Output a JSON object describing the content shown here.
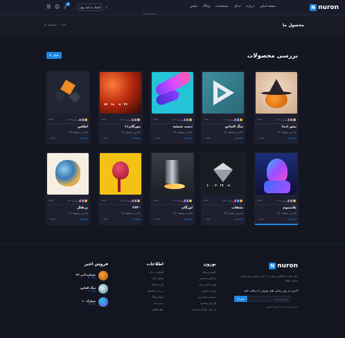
{
  "header": {
    "logo": "nuron",
    "nav": [
      "صفحه اصلی",
      "درباره",
      "جدال",
      "مشخصات",
      "وبلاگ",
      "تماس"
    ],
    "search_placeholder": "جستجو بکنید",
    "wallet_button": "اتصال به کیف پول",
    "notification_count": "6"
  },
  "page": {
    "title": "محصول ما",
    "breadcrumb": [
      "خانه",
      "/",
      "محصول ما"
    ]
  },
  "section": {
    "title": "بررسی محصولات",
    "filter_button": "فیلتر"
  },
  "cards": [
    {
      "name": "پیش ادما",
      "collector": "۱۳+ فروشنده",
      "bid": "بالاترین پیشنهاد ۱/۲",
      "price": "۰/۲۴۴eth",
      "likes": "۳۲۲",
      "img": "pumpkin"
    },
    {
      "name": "سگ الماس",
      "collector": "۱۳+ فروشنده",
      "bid": "بالاترین پیشنهاد ۲/۲",
      "price": "۰/۲۳۴eth",
      "likes": "۳۲۲",
      "img": "triangle"
    },
    {
      "name": "دست شیشه",
      "collector": "۱۳+ فروشنده",
      "bid": "بالاترین پیشنهاد ۴/۲",
      "price": "۰/۲۴۴eth",
      "likes": "۳۲۲",
      "img": "hand"
    },
    {
      "name": "مورگان۱۱",
      "collector": "۱۳+ فروشنده",
      "bid": "بالاترین پیشنهاد ۳/۳",
      "price": "۰/۲۴۴eth",
      "likes": "۳۲۲",
      "img": "flame",
      "timer": [
        "۷۷",
        "۱۸",
        "۰۸",
        "۲۷"
      ]
    },
    {
      "name": "اطلس",
      "collector": "۱۳+ فروشنده",
      "bid": "بالاترین پیشنهاد ۲/۵",
      "price": "۰/۲۴۴eth",
      "likes": "۳۲۲",
      "img": "cubes"
    },
    {
      "name": "پلاتینیوم",
      "collector": "۱۳+ فروشنده",
      "bid": "بالاترین پیشنهاد ۲/۲",
      "price": "۰/۲۴۴eth",
      "likes": "۳۲۲",
      "img": "statue"
    },
    {
      "name": "بشقاب",
      "collector": "۱۳+ فروشنده",
      "bid": "بالاترین پیشنهاد ۳/۳",
      "price": "۰/۲۴۴eth",
      "likes": "۳۲۲",
      "img": "diamond",
      "timer": [
        "۱۰",
        "۰۶",
        "۱۹",
        "۰۸"
      ]
    },
    {
      "name": "اورگان",
      "collector": "۱۳+ فروشنده",
      "bid": "بالاترین پیشنهاد ۲/۲",
      "price": "۰/۲۴۴eth",
      "likes": "۳۲۲",
      "img": "prism"
    },
    {
      "name": "۴۷۳۰",
      "collector": "۱۳+ فروشنده",
      "bid": "بالاترین پیشنهاد ۲/۵",
      "price": "۰/۲۴۴eth",
      "likes": "۳۲۲",
      "img": "heart"
    },
    {
      "name": "پرتقال",
      "collector": "۱۳+ فروشنده",
      "bid": "بالاترین پیشنهاد ۱/۴",
      "price": "۰/۲۴۴eth",
      "likes": "۳۲۲",
      "img": "skull"
    }
  ],
  "footer": {
    "brand": {
      "logo": "nuron",
      "description": "ایجاد شده با همکاری بیش از ۲۰ نفر از بهترین هنرمندان نورون جهان.",
      "newsletter": "آخرین به روز رسانی های نورون را دریافت کنید",
      "email_placeholder": "نام کاربری شما",
      "subscribe": "اشتراک",
      "note": "ایمیل امن است، ما اسپم نمیدهیم."
    },
    "col_nuron": {
      "title": "نورون",
      "links": [
        "کاوش پروتکل",
        "تراکنش سیستم",
        "بهینه سازی زمان",
        "بررسی بصری",
        "سیستم جمع آوری",
        "گزارش وضعیت",
        "از زمان خودکار سیستم"
      ]
    },
    "col_info": {
      "title": "اطلاعات",
      "links": [
        "کاوش در بازار",
        "نوتکن آینده",
        "گزینه اتصال",
        "بررسی محصول",
        "شبکه وبلاگ",
        "درباره ما",
        "رفع اشکال"
      ]
    },
    "col_sales": {
      "title": "فروش اخیر",
      "items": [
        {
          "name": "۲۲ معماره آبی",
          "price": "۲/۰ eth",
          "img": "sale1"
        },
        {
          "name": "سگ الماس",
          "price": "۲/۰ eth",
          "img": "sale2"
        },
        {
          "name": "سیارک ۱۰",
          "price": "۱/۰ eth",
          "img": "sale3"
        }
      ]
    }
  }
}
